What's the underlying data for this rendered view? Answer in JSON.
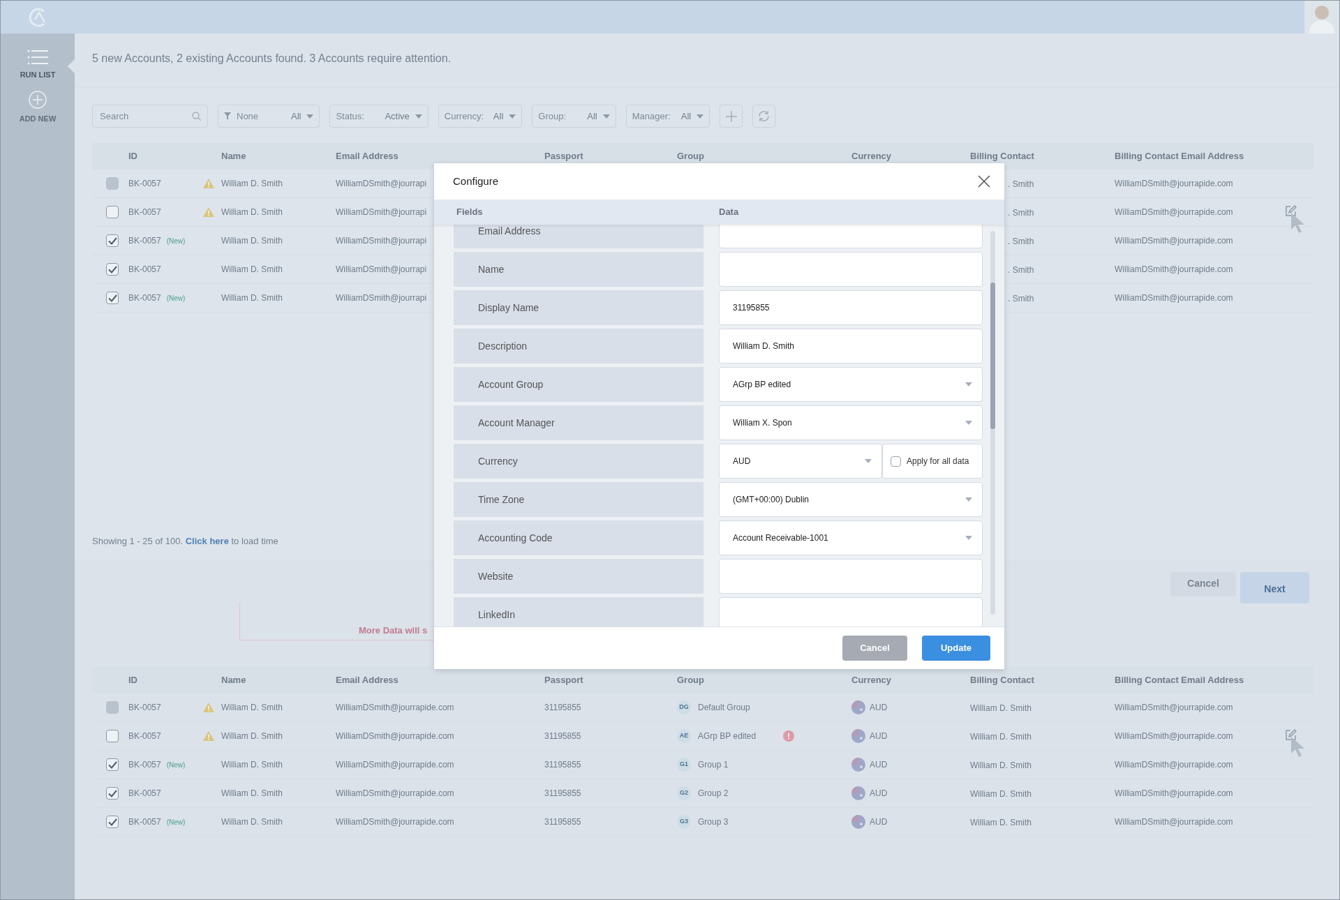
{
  "sidebar": {
    "items": [
      {
        "label": "RUN LIST",
        "kind": "list",
        "selected": true
      },
      {
        "label": "ADD NEW",
        "kind": "add",
        "selected": false
      }
    ]
  },
  "message": "5 new Accounts, 2 existing Accounts found. 3 Accounts require attention.",
  "filters": {
    "search": {
      "placeholder": "Search"
    },
    "dropdowns": [
      {
        "kind": "funnel",
        "label": "None",
        "value": "All"
      },
      {
        "kind": "plain",
        "label": "Status:",
        "value": "Active"
      },
      {
        "kind": "plain",
        "label": "Currency:",
        "value": "All"
      },
      {
        "kind": "plain",
        "label": "Group:",
        "value": "All"
      },
      {
        "kind": "plain",
        "label": "Manager:",
        "value": "All"
      }
    ]
  },
  "upper_table": {
    "columns": [
      "ID",
      "Name",
      "Email Address",
      "Passport",
      "Group",
      "Currency",
      "Billing Contact",
      "Billing Contact Email Address"
    ],
    "rows": [
      {
        "checked": false,
        "disabled": true,
        "id": "BK-0057",
        "warning": true,
        "name": "William D. Smith",
        "email": "WilliamDSmith@jourrapi",
        "billing_contact": ". Smith",
        "billing_email": "WilliamDSmith@jourrapide.com",
        "editing": false
      },
      {
        "checked": false,
        "disabled": false,
        "id": "BK-0057",
        "warning": true,
        "name": "William D. Smith",
        "email": "WilliamDSmith@jourrapi",
        "billing_contact": ". Smith",
        "billing_email": "WilliamDSmith@jourrapide.com",
        "editing": true
      },
      {
        "checked": true,
        "disabled": false,
        "id": "BK-0057",
        "tag": "(New)",
        "warning": false,
        "name": "William D. Smith",
        "email": "WilliamDSmith@jourrapi",
        "billing_contact": ". Smith",
        "billing_email": "WilliamDSmith@jourrapide.com",
        "editing": false
      },
      {
        "checked": true,
        "disabled": false,
        "id": "BK-0057",
        "warning": false,
        "name": "William D. Smith",
        "email": "WilliamDSmith@jourrapi",
        "billing_contact": ". Smith",
        "billing_email": "WilliamDSmith@jourrapide.com",
        "editing": false
      },
      {
        "checked": true,
        "disabled": false,
        "id": "BK-0057",
        "tag": "(New)",
        "warning": false,
        "name": "William D. Smith",
        "email": "WilliamDSmith@jourrapi",
        "billing_contact": ". Smith",
        "billing_email": "WilliamDSmith@jourrapide.com",
        "editing": false
      }
    ]
  },
  "pagination": {
    "text": "Showing 1 - 25 of 100.",
    "link": "Click here",
    "suffix": "to load time"
  },
  "actions": [
    {
      "label": "Cancel",
      "kind": "secondary"
    },
    {
      "label": "Next",
      "kind": "primary"
    }
  ],
  "notice": "More Data will s",
  "lower_table": {
    "columns": [
      "ID",
      "Name",
      "Email Address",
      "Passport",
      "Group",
      "Currency",
      "Billing Contact",
      "Billing Contact Email Address"
    ],
    "rows": [
      {
        "checked": false,
        "disabled": true,
        "id": "BK-0057",
        "warning": true,
        "name": "William D. Smith",
        "email": "WilliamDSmith@jourrapide.com",
        "passport": "31195855",
        "group_initials": "DG",
        "group": "Default Group",
        "error": false,
        "currency": "AUD",
        "billing_contact": "William D. Smith",
        "billing_email": "WilliamDSmith@jourrapide.com",
        "editing": false
      },
      {
        "checked": false,
        "disabled": false,
        "id": "BK-0057",
        "warning": true,
        "name": "William D. Smith",
        "email": "WilliamDSmith@jourrapide.com",
        "passport": "31195855",
        "group_initials": "AE",
        "group": "AGrp BP edited",
        "error": true,
        "currency": "AUD",
        "billing_contact": "William D. Smith",
        "billing_email": "WilliamDSmith@jourrapide.com",
        "editing": true
      },
      {
        "checked": true,
        "disabled": false,
        "id": "BK-0057",
        "tag": "(New)",
        "warning": false,
        "name": "William D. Smith",
        "email": "WilliamDSmith@jourrapide.com",
        "passport": "31195855",
        "group_initials": "G1",
        "group": "Group 1",
        "error": false,
        "currency": "AUD",
        "billing_contact": "William D. Smith",
        "billing_email": "WilliamDSmith@jourrapide.com",
        "editing": false
      },
      {
        "checked": true,
        "disabled": false,
        "id": "BK-0057",
        "warning": false,
        "name": "William D. Smith",
        "email": "WilliamDSmith@jourrapide.com",
        "passport": "31195855",
        "group_initials": "G2",
        "group": "Group 2",
        "error": false,
        "currency": "AUD",
        "billing_contact": "William D. Smith",
        "billing_email": "WilliamDSmith@jourrapide.com",
        "editing": false
      },
      {
        "checked": true,
        "disabled": false,
        "id": "BK-0057",
        "tag": "(New)",
        "warning": false,
        "name": "William D. Smith",
        "email": "WilliamDSmith@jourrapide.com",
        "passport": "31195855",
        "group_initials": "G3",
        "group": "Group 3",
        "error": false,
        "currency": "AUD",
        "billing_contact": "William D. Smith",
        "billing_email": "WilliamDSmith@jourrapide.com",
        "editing": false
      }
    ]
  },
  "modal": {
    "title": "Configure",
    "columns": [
      "Fields",
      "Data"
    ],
    "fields": [
      {
        "label": "Email Address",
        "kind": "text"
      },
      {
        "label": "Name",
        "kind": "text"
      },
      {
        "label": "Display Name",
        "kind": "text",
        "value": "31195855"
      },
      {
        "label": "Description",
        "kind": "text",
        "value": "William D. Smith"
      },
      {
        "label": "Account Group",
        "kind": "select",
        "value": "AGrp BP edited"
      },
      {
        "label": "Account Manager",
        "kind": "select",
        "value": "William X. Spon"
      },
      {
        "label": "Currency",
        "kind": "currency",
        "value": "AUD",
        "option": {
          "label": "Apply for all data",
          "checked": false
        }
      },
      {
        "label": "Time Zone",
        "kind": "select",
        "value": "(GMT+00:00) Dublin"
      },
      {
        "label": "Accounting Code",
        "kind": "select",
        "value": "Account Receivable-1001"
      },
      {
        "label": "Website",
        "kind": "text"
      },
      {
        "label": "LinkedIn",
        "kind": "text"
      }
    ],
    "buttons": [
      {
        "label": "Cancel",
        "kind": "secondary"
      },
      {
        "label": "Update",
        "kind": "primary"
      }
    ]
  }
}
